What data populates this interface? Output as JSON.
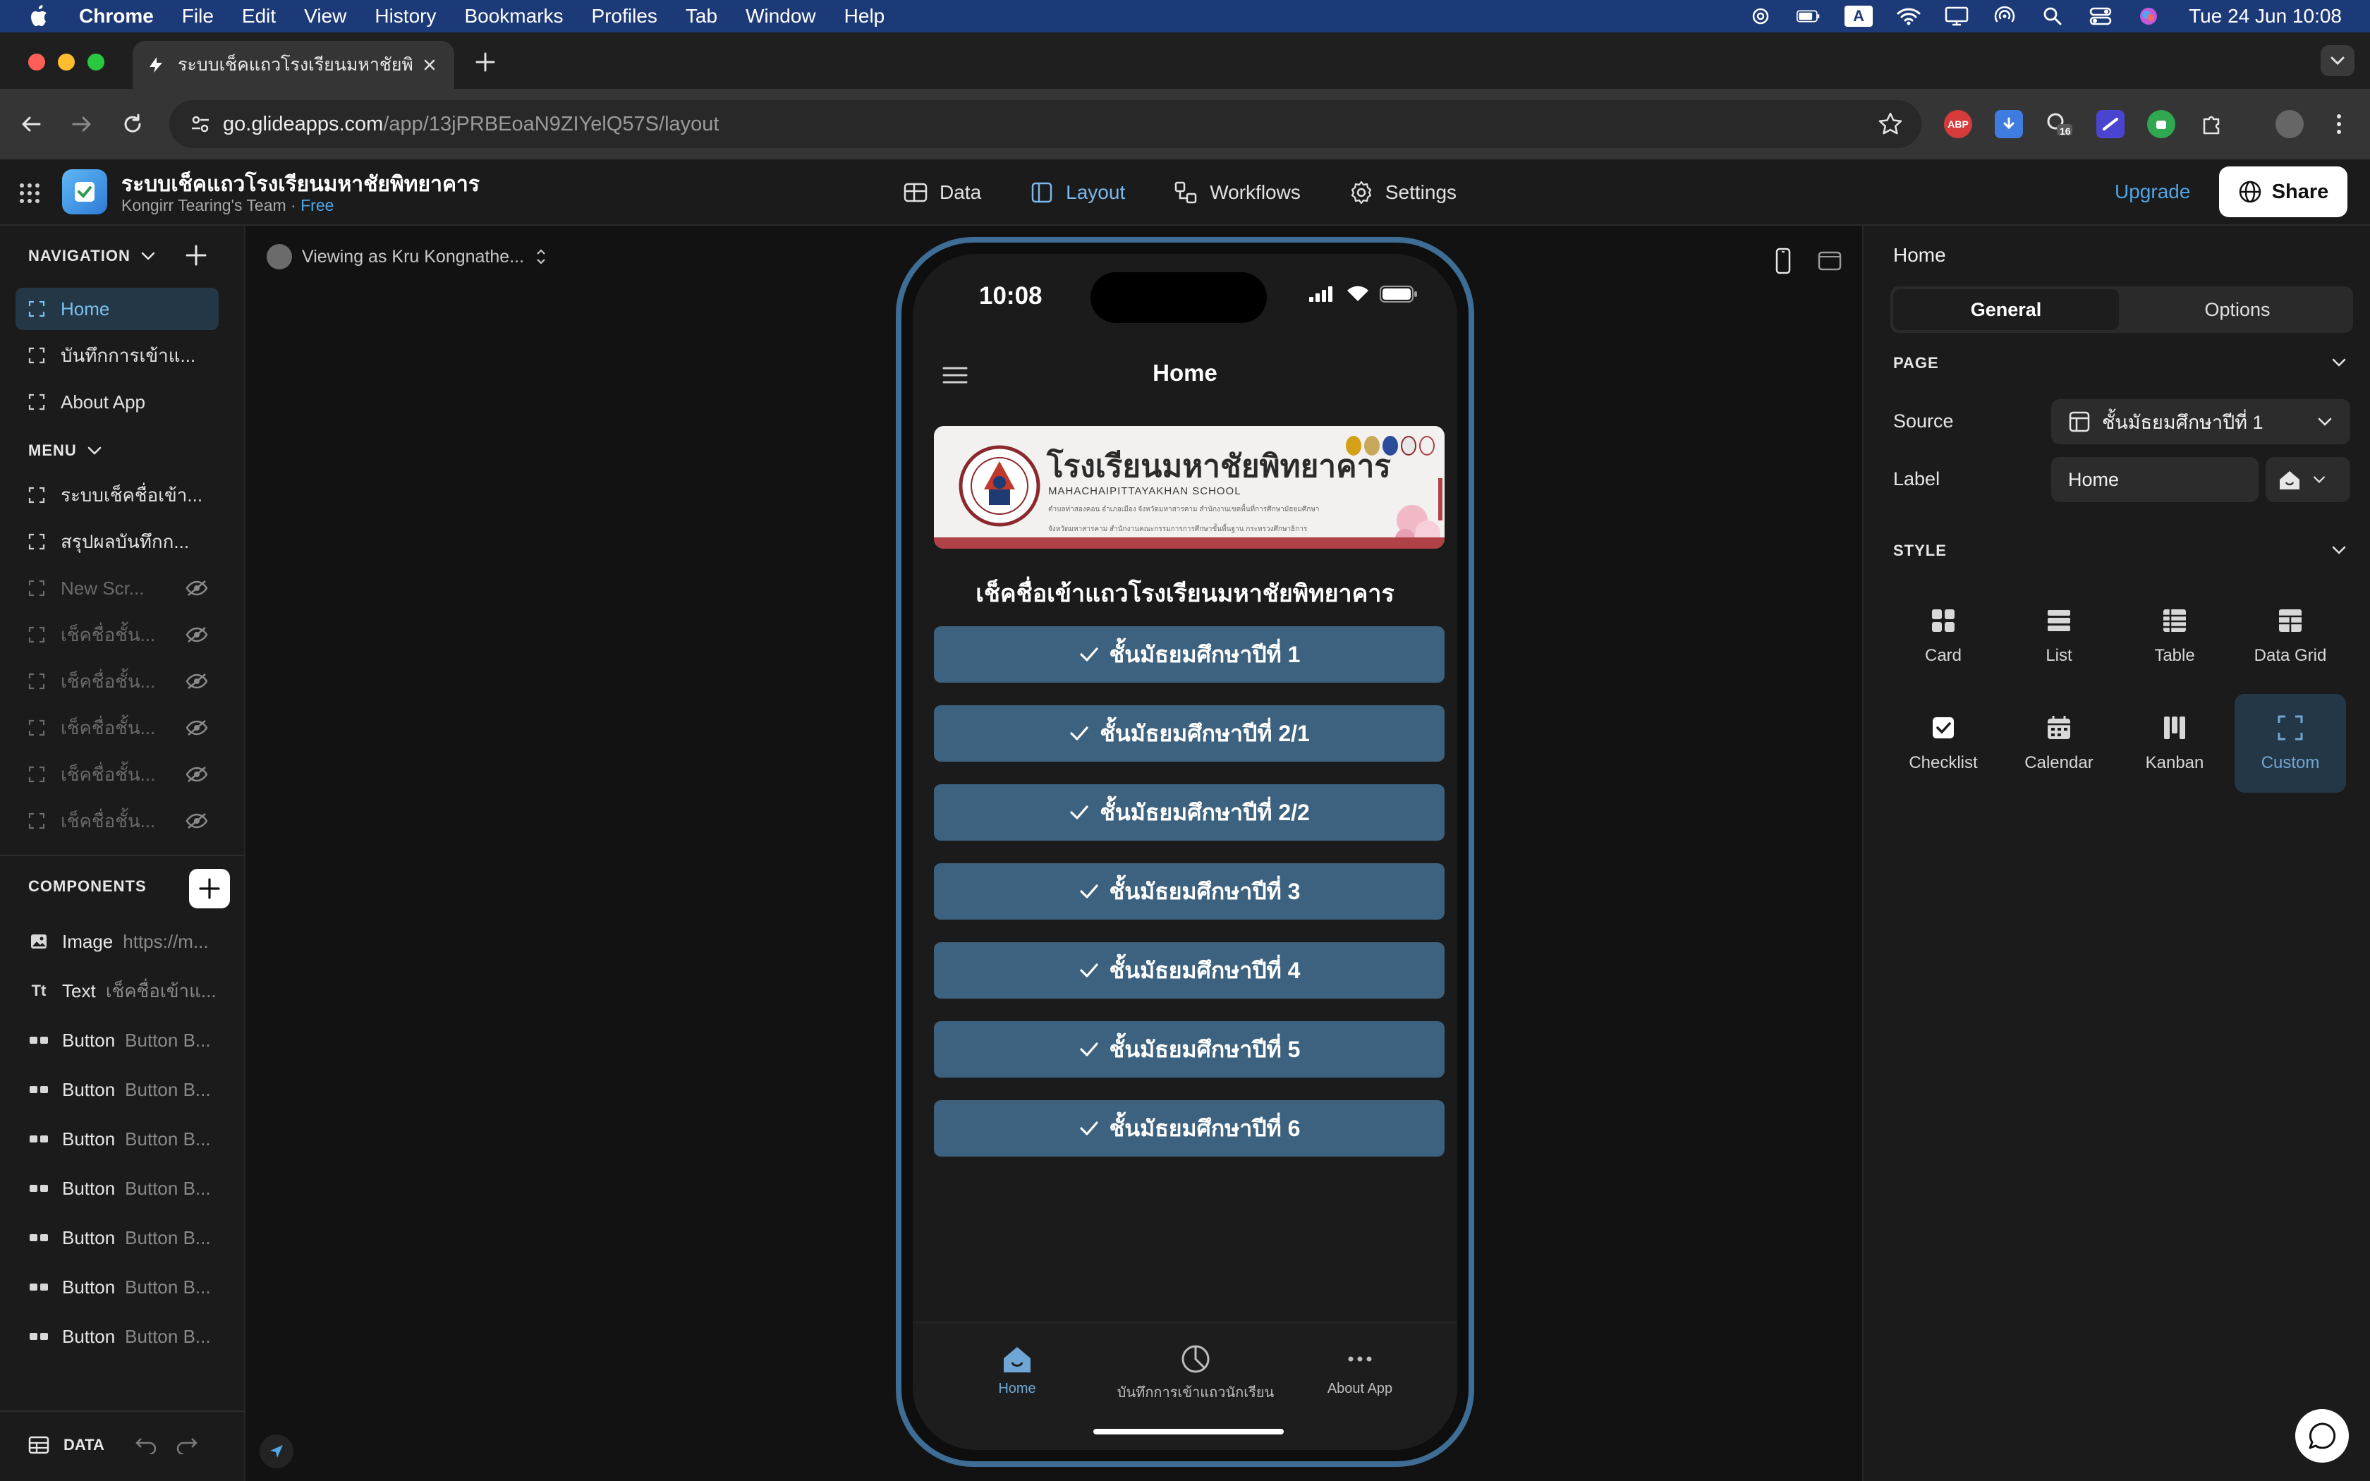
{
  "menubar": {
    "app": "Chrome",
    "items": [
      "File",
      "Edit",
      "View",
      "History",
      "Bookmarks",
      "Profiles",
      "Tab",
      "Window",
      "Help"
    ],
    "input_badge": "A",
    "clock": "Tue 24 Jun  10:08"
  },
  "browser": {
    "tab_title": "ระบบเช็คแถวโรงเรียนมหาชัยพิทย",
    "url_host": "go.glideapps.com",
    "url_path": "/app/13jPRBEoaN9ZIYelQ57S/layout",
    "ext_abp": "ABP",
    "ext_badge": "16"
  },
  "app": {
    "title": "ระบบเช็คแถวโรงเรียนมหาชัยพิทยาคาร",
    "team": "Kongirr Tearing's Team",
    "separator": " · ",
    "plan": "Free",
    "nav": [
      {
        "label": "Data",
        "icon": "table-icon"
      },
      {
        "label": "Layout",
        "icon": "layout-icon"
      },
      {
        "label": "Workflows",
        "icon": "workflow-icon"
      },
      {
        "label": "Settings",
        "icon": "gear-icon"
      }
    ],
    "upgrade": "Upgrade",
    "share": "Share"
  },
  "sidebar": {
    "navigation_title": "NAVIGATION",
    "navigation": [
      {
        "label": "Home",
        "active": true
      },
      {
        "label": "บันทึกการเข้าแ...",
        "active": false
      },
      {
        "label": "About App",
        "active": false
      }
    ],
    "menu_title": "MENU",
    "menu": [
      {
        "label": "ระบบเช็คชื่อเข้า...",
        "hidden": false
      },
      {
        "label": "สรุปผลบันทึกก...",
        "hidden": false
      },
      {
        "label": "New Scr...",
        "hidden": true
      },
      {
        "label": "เช็คชื่อชั้น...",
        "hidden": true
      },
      {
        "label": "เช็คชื่อชั้น...",
        "hidden": true
      },
      {
        "label": "เช็คชื่อชั้น...",
        "hidden": true
      },
      {
        "label": "เช็คชื่อชั้น...",
        "hidden": true
      },
      {
        "label": "เช็คชื่อชั้น...",
        "hidden": true
      }
    ],
    "components_title": "COMPONENTS",
    "components": [
      {
        "icon": "▣",
        "type": "Image",
        "value": "https://m..."
      },
      {
        "icon": "Tt",
        "type": "Text",
        "value": "เช็คชื่อเข้าแ..."
      },
      {
        "icon": "▭▭",
        "type": "Button",
        "value": "Button B..."
      },
      {
        "icon": "▭▭",
        "type": "Button",
        "value": "Button B..."
      },
      {
        "icon": "▭▭",
        "type": "Button",
        "value": "Button B..."
      },
      {
        "icon": "▭▭",
        "type": "Button",
        "value": "Button B..."
      },
      {
        "icon": "▭▭",
        "type": "Button",
        "value": "Button B..."
      },
      {
        "icon": "▭▭",
        "type": "Button",
        "value": "Button B..."
      },
      {
        "icon": "▭▭",
        "type": "Button",
        "value": "Button B..."
      }
    ],
    "footer_data": "DATA"
  },
  "canvas": {
    "viewing_as": "Viewing as Kru Kongnathe..."
  },
  "phone": {
    "time": "10:08",
    "title": "Home",
    "banner": {
      "school_th": "โรงเรียนมหาชัยพิทยาคาร",
      "school_en": "MAHACHAIPITTAYAKHAN SCHOOL",
      "line1": "ตำบลท่าสองคอน อำเภอเมือง จังหวัดมหาสารคาม สำนักงานเขตพื้นที่การศึกษามัธยมศึกษา",
      "line2": "จังหวัดมหาสารคาม สำนักงานคณะกรรมการการศึกษาขั้นพื้นฐาน กระทรวงศึกษาธิการ"
    },
    "heading": "เช็คชื่อเข้าแถวโรงเรียนมหาชัยพิทยาคาร",
    "buttons": [
      "ชั้นมัธยมศึกษาปีที่ 1",
      "ชั้นมัธยมศึกษาปีที่ 2/1",
      "ชั้นมัธยมศึกษาปีที่ 2/2",
      "ชั้นมัธยมศึกษาปีที่ 3",
      "ชั้นมัธยมศึกษาปีที่ 4",
      "ชั้นมัธยมศึกษาปีที่ 5",
      "ชั้นมัธยมศึกษาปีที่ 6"
    ],
    "tabs": [
      {
        "label": "Home",
        "icon": "home-icon",
        "active": true
      },
      {
        "label": "บันทึกการเข้าแถวนักเรียน",
        "icon": "pie-chart-icon",
        "active": false
      },
      {
        "label": "About App",
        "icon": "more-icon",
        "active": false
      }
    ]
  },
  "inspector": {
    "title": "Home",
    "tabs": [
      "General",
      "Options"
    ],
    "active_tab": "General",
    "page_section": "PAGE",
    "source_label": "Source",
    "source_value": "ชั้นมัธยมศึกษาปีที่ 1",
    "label_label": "Label",
    "label_value": "Home",
    "style_section": "STYLE",
    "styles": [
      "Card",
      "List",
      "Table",
      "Data Grid",
      "Checklist",
      "Calendar",
      "Kanban",
      "Custom"
    ],
    "active_style": "Custom"
  },
  "colors": {
    "accent": "#4fa6e8",
    "button_bg": "#3d627f",
    "phone_frame": "#3e6d96",
    "active_bg": "#243746"
  }
}
